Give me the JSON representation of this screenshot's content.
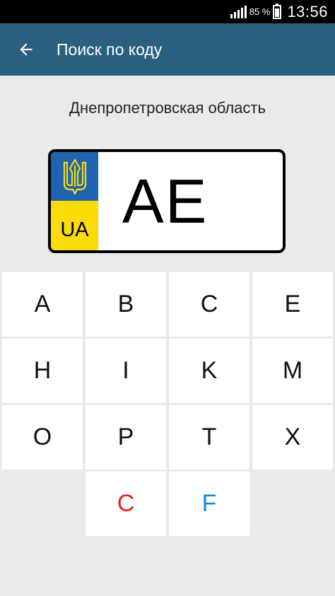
{
  "status_bar": {
    "battery_percent": "85 %",
    "battery_level": 0.85,
    "time": "13:56",
    "signal_icon": "signal-bars-icon",
    "battery_icon": "battery-icon"
  },
  "app_bar": {
    "title": "Поиск по коду",
    "back_icon": "arrow-left-icon",
    "background": "#2a607f"
  },
  "region_name": "Днепропетровская область",
  "plate": {
    "country": "UA",
    "code": "AE",
    "emblem_icon": "trident-icon",
    "flag_blue": "#1f63b1",
    "flag_yellow": "#fadc0a"
  },
  "keypad": {
    "keys": [
      {
        "label": "A",
        "color": "#111111"
      },
      {
        "label": "B",
        "color": "#111111"
      },
      {
        "label": "C",
        "color": "#111111"
      },
      {
        "label": "E",
        "color": "#111111"
      },
      {
        "label": "H",
        "color": "#111111"
      },
      {
        "label": "I",
        "color": "#111111"
      },
      {
        "label": "K",
        "color": "#111111"
      },
      {
        "label": "M",
        "color": "#111111"
      },
      {
        "label": "O",
        "color": "#111111"
      },
      {
        "label": "P",
        "color": "#111111"
      },
      {
        "label": "T",
        "color": "#111111"
      },
      {
        "label": "X",
        "color": "#111111"
      },
      {
        "label": "C",
        "color": "#e2231a"
      },
      {
        "label": "F",
        "color": "#1a8ad6"
      }
    ]
  }
}
